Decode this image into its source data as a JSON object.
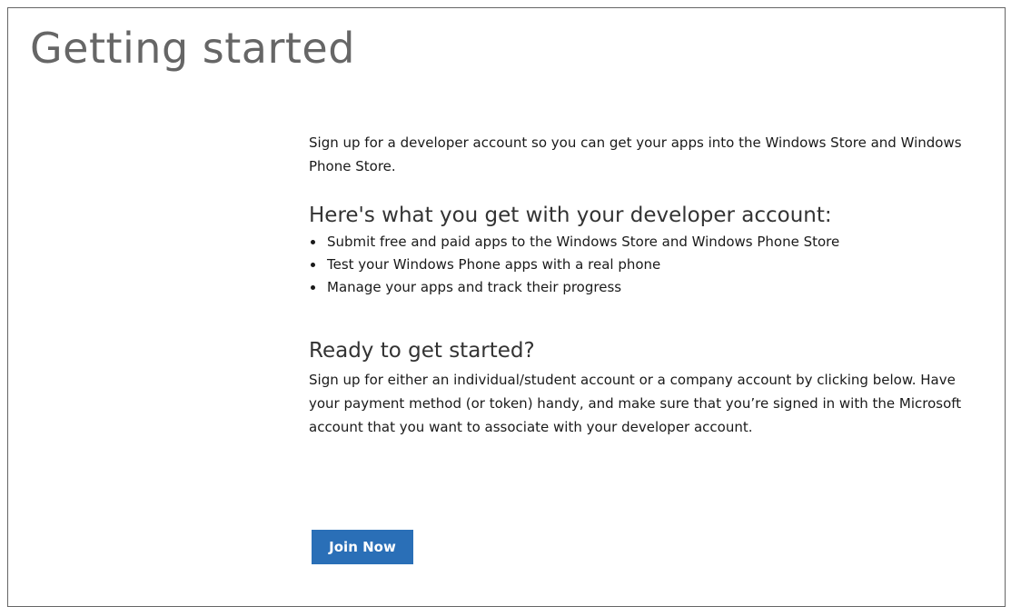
{
  "page": {
    "title": "Getting started"
  },
  "intro": {
    "text": "Sign up for a developer account so you can get your apps into the Windows Store and Windows Phone Store."
  },
  "benefits": {
    "heading": "Here's what you get with your developer account:",
    "items": [
      "Submit free and paid apps to the Windows Store and Windows Phone Store",
      "Test your Windows Phone apps with a real phone",
      "Manage your apps and track their progress"
    ]
  },
  "ready": {
    "heading": "Ready to get started?",
    "text": "Sign up for either an individual/student account or a company account by clicking below. Have your payment method (or token) handy, and make sure that you’re signed in with the Microsoft account that you want to associate with your developer account."
  },
  "actions": {
    "join_label": "Join Now"
  },
  "colors": {
    "button_bg": "#2a6fb7",
    "title_gray": "#666666"
  }
}
